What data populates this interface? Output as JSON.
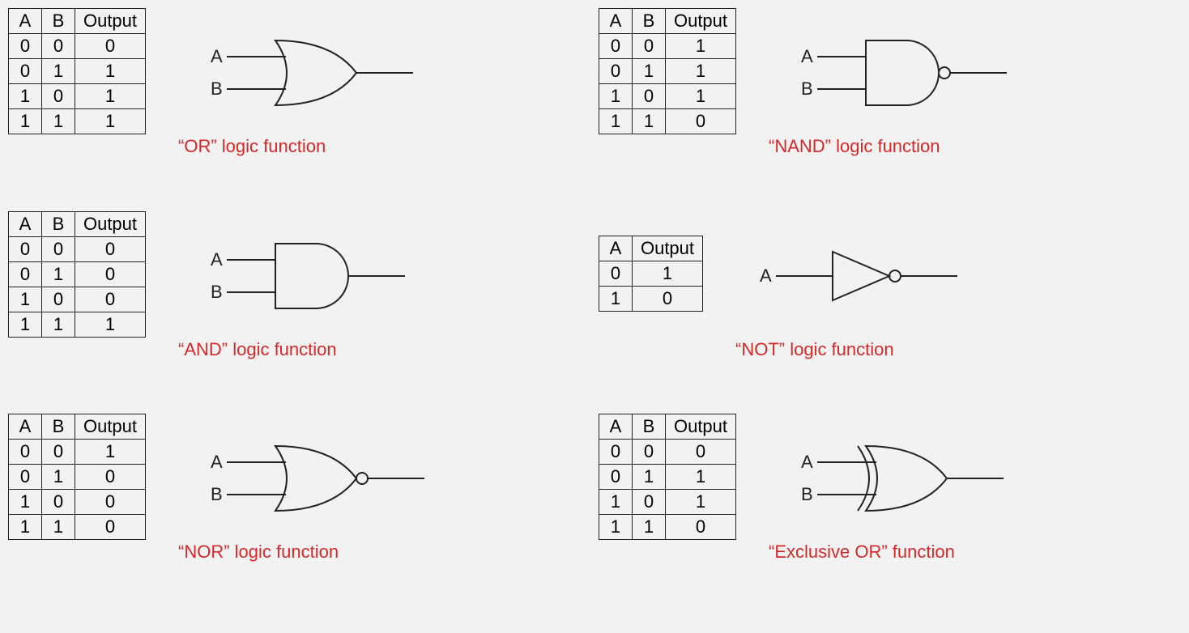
{
  "headers2": [
    "A",
    "B",
    "Output"
  ],
  "headers1": [
    "A",
    "Output"
  ],
  "inputs": {
    "A": "A",
    "B": "B"
  },
  "gates": [
    {
      "id": "or",
      "caption": "“OR” logic function",
      "cols": 2,
      "rows": [
        [
          "0",
          "0",
          "0"
        ],
        [
          "0",
          "1",
          "1"
        ],
        [
          "1",
          "0",
          "1"
        ],
        [
          "1",
          "1",
          "1"
        ]
      ]
    },
    {
      "id": "nand",
      "caption": "“NAND” logic function",
      "cols": 2,
      "rows": [
        [
          "0",
          "0",
          "1"
        ],
        [
          "0",
          "1",
          "1"
        ],
        [
          "1",
          "0",
          "1"
        ],
        [
          "1",
          "1",
          "0"
        ]
      ]
    },
    {
      "id": "and",
      "caption": "“AND” logic function",
      "cols": 2,
      "rows": [
        [
          "0",
          "0",
          "0"
        ],
        [
          "0",
          "1",
          "0"
        ],
        [
          "1",
          "0",
          "0"
        ],
        [
          "1",
          "1",
          "1"
        ]
      ]
    },
    {
      "id": "not",
      "caption": "“NOT” logic function",
      "cols": 1,
      "rows": [
        [
          "0",
          "1"
        ],
        [
          "1",
          "0"
        ]
      ]
    },
    {
      "id": "nor",
      "caption": "“NOR” logic function",
      "cols": 2,
      "rows": [
        [
          "0",
          "0",
          "1"
        ],
        [
          "0",
          "1",
          "0"
        ],
        [
          "1",
          "0",
          "0"
        ],
        [
          "1",
          "1",
          "0"
        ]
      ]
    },
    {
      "id": "xor",
      "caption": "“Exclusive OR” function",
      "cols": 2,
      "rows": [
        [
          "0",
          "0",
          "0"
        ],
        [
          "0",
          "1",
          "1"
        ],
        [
          "1",
          "0",
          "1"
        ],
        [
          "1",
          "1",
          "0"
        ]
      ]
    }
  ]
}
